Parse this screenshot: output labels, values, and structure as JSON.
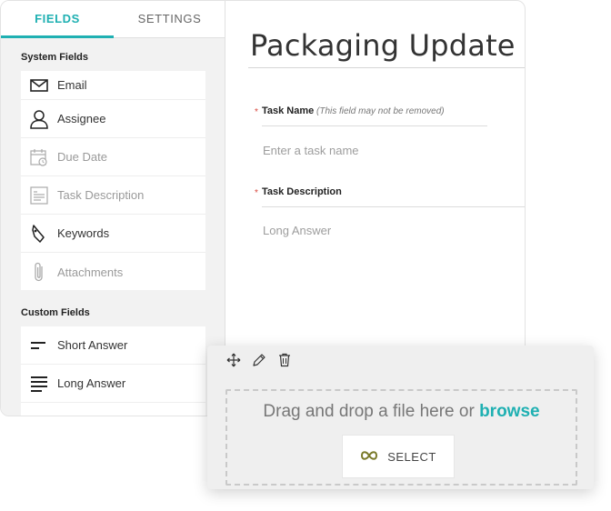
{
  "tabs": {
    "fields": "FIELDS",
    "settings": "SETTINGS"
  },
  "system_fields": {
    "title": "System Fields",
    "items": [
      {
        "label": "Email",
        "icon": "envelope-icon",
        "enabled": true
      },
      {
        "label": "Assignee",
        "icon": "person-icon",
        "enabled": true
      },
      {
        "label": "Due Date",
        "icon": "calendar-icon",
        "enabled": false
      },
      {
        "label": "Task Description",
        "icon": "description-icon",
        "enabled": false
      },
      {
        "label": "Keywords",
        "icon": "tag-icon",
        "enabled": true
      },
      {
        "label": "Attachments",
        "icon": "paperclip-icon",
        "enabled": false
      }
    ]
  },
  "custom_fields": {
    "title": "Custom Fields",
    "items": [
      {
        "label": "Short Answer",
        "icon": "short-answer-icon"
      },
      {
        "label": "Long Answer",
        "icon": "long-answer-icon"
      }
    ]
  },
  "form": {
    "title": "Packaging Update",
    "task_name": {
      "required": "*",
      "label": "Task Name",
      "hint": "(This field may not be removed)",
      "placeholder": "Enter a task name"
    },
    "task_description": {
      "required": "*",
      "label": "Task Description",
      "placeholder": "Long Answer"
    }
  },
  "upload": {
    "drop_text": "Drag and drop a file here or",
    "browse_label": "browse",
    "select_label": "SELECT"
  },
  "colors": {
    "accent": "#1fb0b2",
    "required": "#d9463d"
  }
}
